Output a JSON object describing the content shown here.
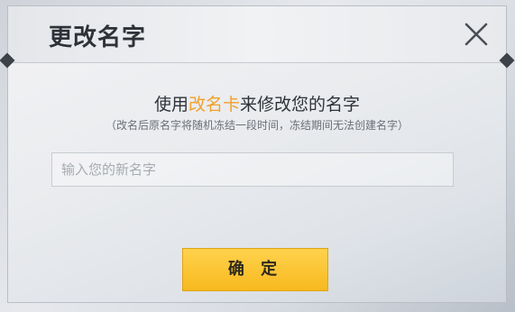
{
  "dialog": {
    "title": "更改名字",
    "instruction_prefix": "使用",
    "instruction_highlight": "改名卡",
    "instruction_suffix": "来修改您的名字",
    "note": "（改名后原名字将随机冻结一段时间，冻结期间无法创建名字）",
    "input_placeholder": "输入您的新名字",
    "input_value": "",
    "confirm_label": "确 定"
  },
  "icons": {
    "close": "close-icon"
  },
  "colors": {
    "highlight": "#f2a02a",
    "confirm_button": "#f7b91f"
  }
}
